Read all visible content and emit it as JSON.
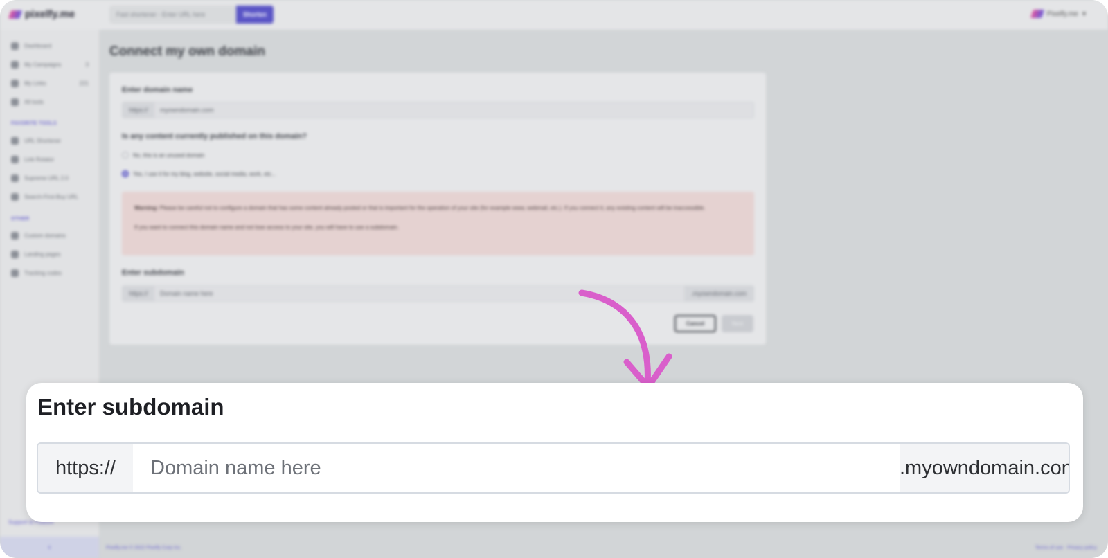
{
  "app": {
    "brand": "pixelfy.me",
    "account_label": "Pixelfy.me",
    "shortener_placeholder": "Fast shortener - Enter URL here",
    "shorten_label": "Shorten"
  },
  "sidebar": {
    "items": [
      {
        "label": "Dashboard",
        "count": ""
      },
      {
        "label": "My Campaigns",
        "count": "3"
      },
      {
        "label": "My Links",
        "count": "221"
      },
      {
        "label": "All tools",
        "count": ""
      }
    ],
    "favorite_heading": "FAVORITE TOOLS",
    "favorites": [
      {
        "label": "URL Shortener"
      },
      {
        "label": "Link Rotator"
      },
      {
        "label": "Supreme URL 2.0"
      },
      {
        "label": "Search-First-Buy URL"
      }
    ],
    "other_heading": "OTHER",
    "other": [
      {
        "label": "Custom domains"
      },
      {
        "label": "Landing pages"
      },
      {
        "label": "Tracking codes"
      }
    ],
    "support_label": "Support & Feature",
    "collapse_icon": "‹"
  },
  "page": {
    "title": "Connect my own domain",
    "domain_label": "Enter domain name",
    "domain_prefix": "https://",
    "domain_value": "myowndomain.com",
    "question": "Is any content currently published on this domain?",
    "option_no": "No, this is an unused domain",
    "option_yes": "Yes, I use it for my blog, website, social media, work, etc...",
    "warning_title": "Warning:",
    "warning_text": "Please be careful not to configure a domain that has some content already posted or that is important for the operation of your site (for example www, webmail, etc.). If you connect it, any existing content will be inaccessible.",
    "warning_text2": "If you want to connect this domain name and not lose access to your site, you will have to use a subdomain.",
    "subdomain_label": "Enter subdomain",
    "subdomain_prefix": "https://",
    "subdomain_placeholder": "Domain name here",
    "subdomain_suffix": ".myowndomain.com",
    "cancel_label": "Cancel",
    "next_label": "Next"
  },
  "footer": {
    "left": "Pixelfy.me © 2022 Pixelfy Corp Inc.",
    "right": "Terms of use · Privacy policy"
  },
  "callout": {
    "title": "Enter subdomain",
    "prefix": "https://",
    "placeholder": "Domain name here",
    "suffix": ".myowndomain.com"
  },
  "colors": {
    "accent": "#5a55c6",
    "arrow": "#d95fcb"
  }
}
